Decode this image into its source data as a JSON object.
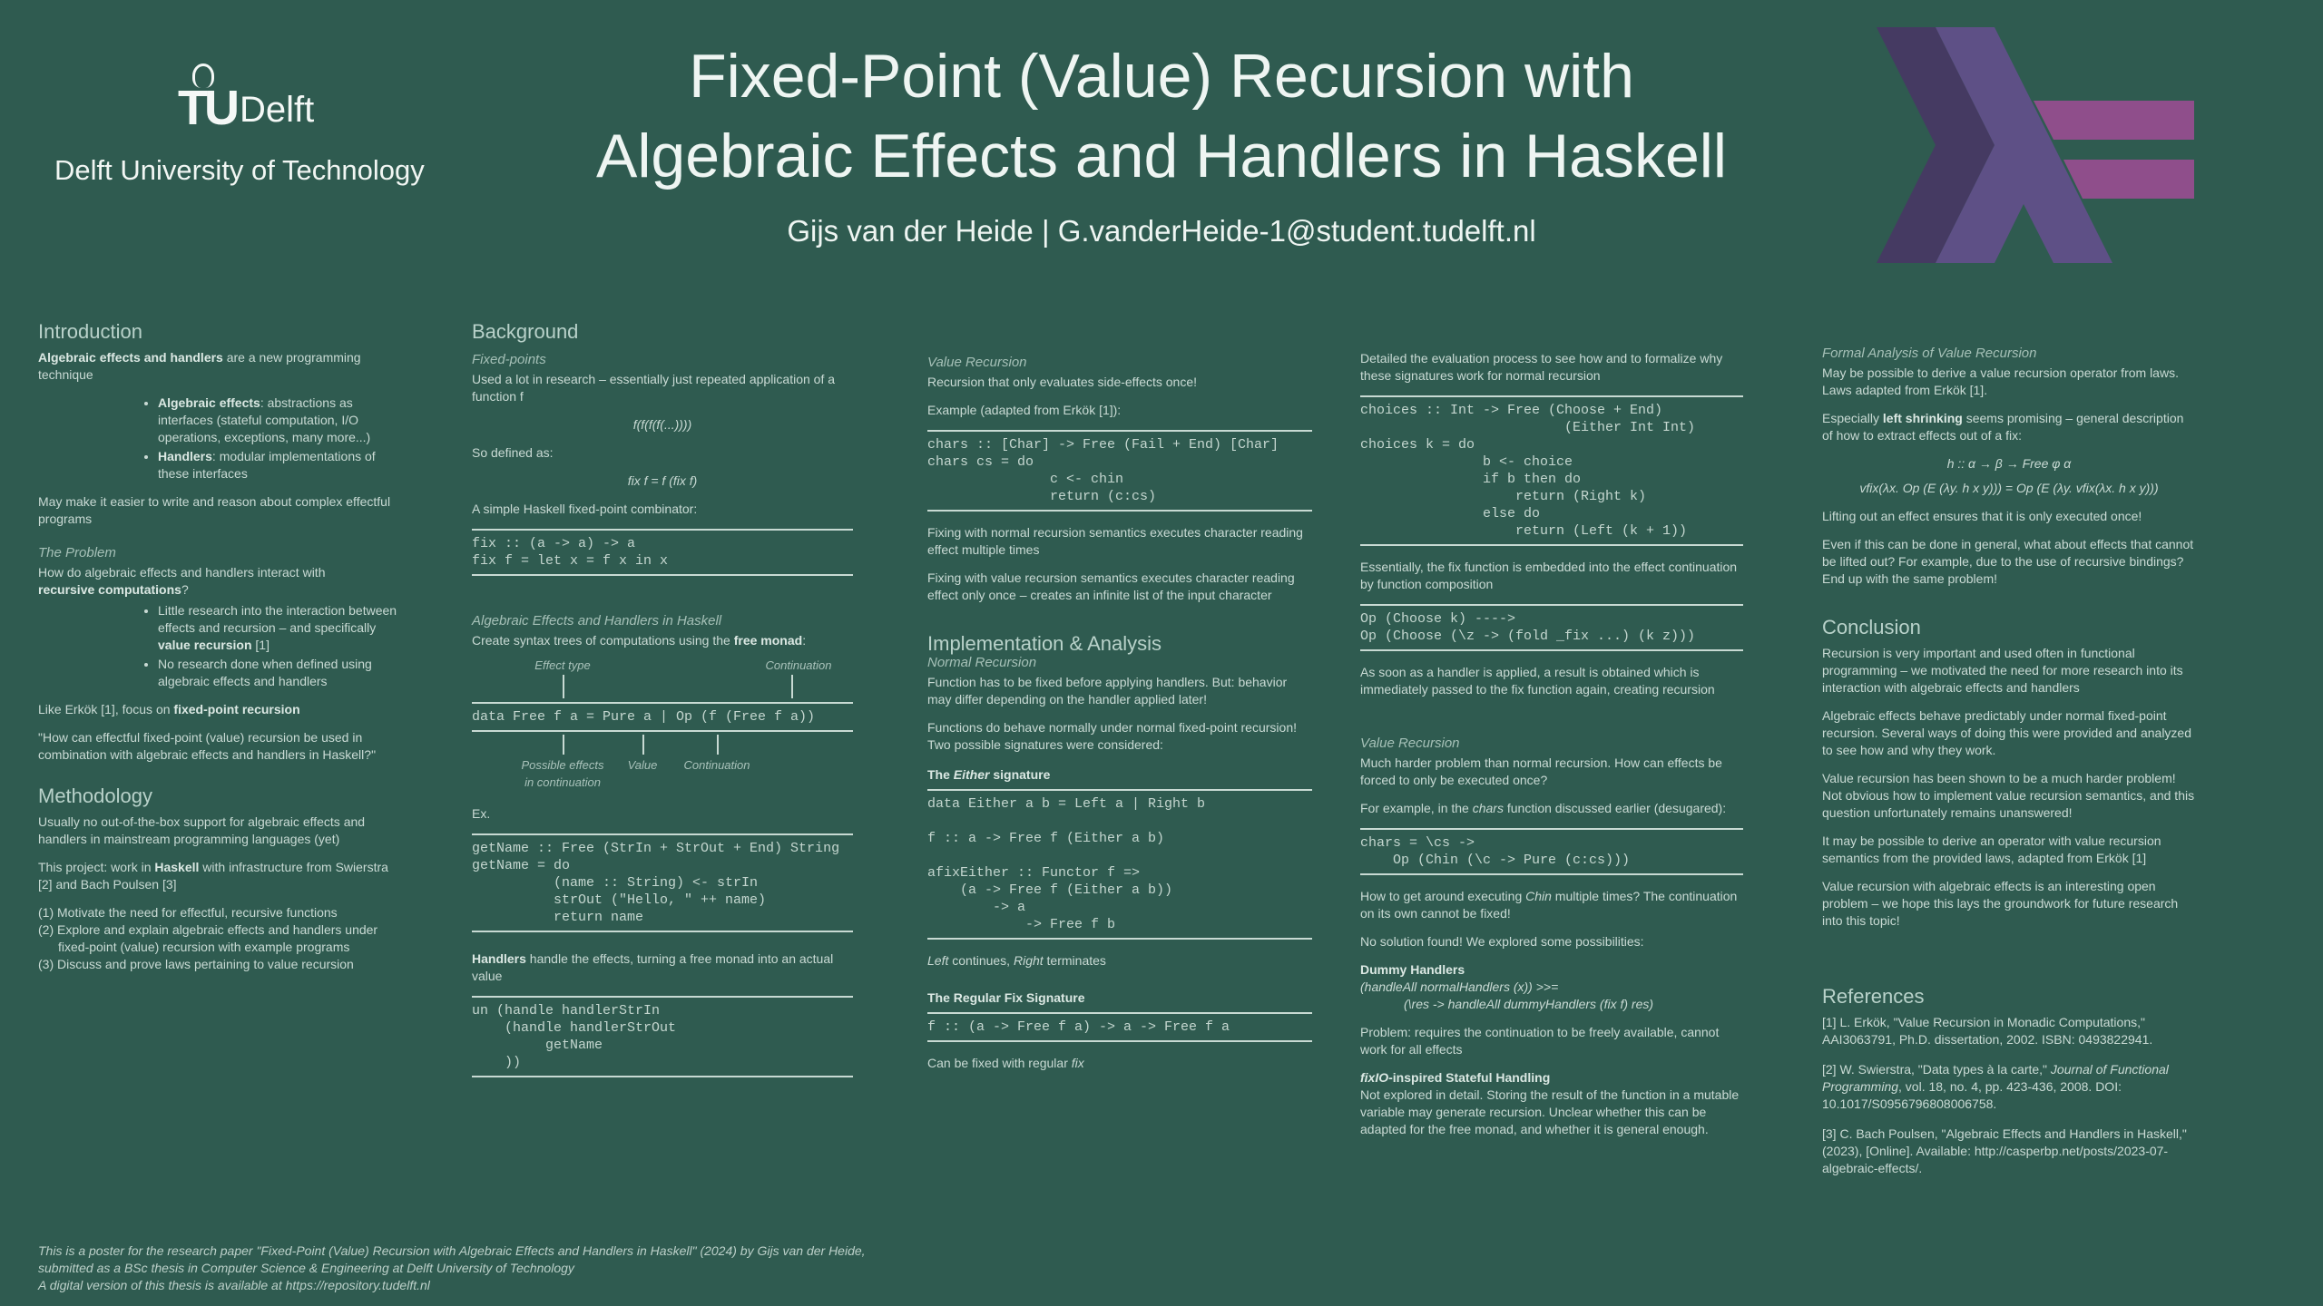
{
  "header": {
    "logo_text": "TU",
    "logo_word": "Delft",
    "university": "Delft University of Technology",
    "title_line1": "Fixed-Point (Value) Recursion with",
    "title_line2": "Algebraic Effects and Handlers in Haskell",
    "author": "Gijs van der Heide | G.vanderHeide-1@student.tudelft.nl",
    "haskell_logo_colors": [
      "#453a62",
      "#5e5086",
      "#8f4e8b"
    ]
  },
  "intro": {
    "heading": "Introduction",
    "p1_bold": "Algebraic effects and handlers",
    "p1_rest": " are a new programming technique",
    "b1_bold": "Algebraic effects",
    "b1_rest": ": abstractions as interfaces (stateful computation, I/O operations, exceptions, many more...)",
    "b2_bold": "Handlers",
    "b2_rest": ": modular implementations of these interfaces",
    "p2": "May make it easier to write and reason about complex effectful programs",
    "problem_heading": "The Problem",
    "problem_p": "How do algebraic effects and handlers interact with",
    "problem_bold": "recursive computations",
    "problem_q": "?",
    "pb1_pre": "Little research into the interaction between effects and recursion – and specifically ",
    "pb1_bold": "value recursion",
    "pb1_post": " [1]",
    "pb2": "No research done when defined using algebraic effects and handlers",
    "erkok_pre": "Like Erkök [1], focus on ",
    "erkok_bold": "fixed-point recursion",
    "question": "\"How can effectful fixed-point (value) recursion be used in combination with algebraic effects and handlers in Haskell?\""
  },
  "method": {
    "heading": "Methodology",
    "p1": "Usually no out-of-the-box support for algebraic effects and handlers in mainstream programming languages (yet)",
    "p2_pre": "This project: work in ",
    "p2_bold": "Haskell",
    "p2_post": " with infrastructure from Swierstra [2] and Bach Poulsen [3]",
    "steps": [
      "(1) Motivate the need for effectful, recursive functions",
      "(2) Explore and explain algebraic effects and handlers under fixed-point (value) recursion with example programs",
      "(3) Discuss and prove laws pertaining to value recursion"
    ]
  },
  "background": {
    "heading": "Background",
    "fp_heading": "Fixed-points",
    "fp_p": "Used a lot in research – essentially just repeated application of a function f",
    "fp_math": "f(f(f(f(...))))",
    "fp_defined": "So defined as:",
    "fp_def": "fix f = f (fix f)",
    "fp_simple": "A simple Haskell fixed-point combinator:",
    "fix_code": "fix :: (a -> a) -> a\nfix f = let x = f x in x",
    "ae_heading": "Algebraic Effects and Handlers in Haskell",
    "ae_p_pre": "Create syntax trees of computations using the ",
    "ae_p_bold": "free monad",
    "ae_p_post": ":",
    "lab_effect_type": "Effect type",
    "lab_continuation_top": "Continuation",
    "free_code": "data Free f a = Pure a | Op (f (Free f a))",
    "lab_possible": "Possible effects in continuation",
    "lab_value": "Value",
    "lab_continuation_bot": "Continuation",
    "ex": "Ex.",
    "getname_code": "getName :: Free (StrIn + StrOut + End) String\ngetName = do\n          (name :: String) <- strIn\n          strOut (\"Hello, \" ++ name)\n          return name",
    "handlers_bold": "Handlers",
    "handlers_rest": " handle the effects, turning a free monad into an actual value",
    "handle_code": "un (handle handlerStrIn\n    (handle handlerStrOut\n         getName\n    ))"
  },
  "value_rec": {
    "heading": "Value Recursion",
    "p1": "Recursion that only evaluates side-effects once!",
    "example": "Example (adapted from Erkök [1]):",
    "chars_code": "chars :: [Char] -> Free (Fail + End) [Char]\nchars cs = do\n               c <- chin\n               return (c:cs)",
    "p2": "Fixing with normal recursion semantics executes character reading effect multiple times",
    "p3": "Fixing with value recursion semantics executes character reading effect only once – creates an infinite list of the input character",
    "impl_heading": "Implementation & Analysis",
    "normal_heading": "Normal Recursion",
    "normal_p1": "Function has to be fixed before applying handlers. But: behavior may differ depending on the handler applied later!",
    "normal_p2": "Functions do behave normally under normal fixed-point recursion! Two possible signatures were considered:",
    "either_sub_pre": "The ",
    "either_sub_it": "Either",
    "either_sub_post": " signature",
    "either_code": "data Either a b = Left a | Right b\n\nf :: a -> Free f (Either a b)\n\nafixEither :: Functor f =>\n    (a -> Free f (Either a b))\n        -> a\n            -> Free f b",
    "either_note_it1": "Left",
    "either_note_mid": " continues, ",
    "either_note_it2": "Right",
    "either_note_post": " terminates",
    "regular_sub": "The Regular Fix Signature",
    "regular_code": "f :: (a -> Free f a) -> a -> Free f a",
    "regular_note_pre": "Can be fixed with regular ",
    "regular_note_it": "fix"
  },
  "col4": {
    "p1": "Detailed the evaluation process to see how and to formalize why these signatures work for normal recursion",
    "choices_code": "choices :: Int -> Free (Choose + End)\n                         (Either Int Int)\nchoices k = do\n               b <- choice\n               if b then do\n                   return (Right k)\n               else do\n                   return (Left (k + 1))",
    "p2": "Essentially, the fix function is embedded into the effect continuation by function composition",
    "cont_code": "Op (Choose k) ---->\nOp (Choose (\\z -> (fold _fix ...) (k z)))",
    "p3": "As soon as a handler is applied, a result is obtained which is immediately passed to the fix function again, creating recursion",
    "vr_heading": "Value Recursion",
    "vr_p1": "Much harder problem than normal recursion. How can effects be forced to only be executed once?",
    "vr_p2_pre": "For example, in the ",
    "vr_p2_it": "chars",
    "vr_p2_post": " function discussed earlier (desugared):",
    "chars2_code": "chars = \\cs ->\n    Op (Chin (\\c -> Pure (c:cs)))",
    "vr_p3_pre": "How to get around executing ",
    "vr_p3_it": "Chin",
    "vr_p3_post": " multiple times? The continuation on its own cannot be fixed!",
    "vr_p4": "No solution found! We explored some possibilities:",
    "dummy_bold": "Dummy Handlers",
    "dummy_line1": "(handleAll normalHandlers (x)) >>=",
    "dummy_line2": "(\\res -> handleAll dummyHandlers (fix f) res)",
    "problem_text": "Problem: requires the continuation to be freely available, cannot work for all effects",
    "fixio_bold_it": "fixIO",
    "fixio_bold_rest": "-inspired Stateful Handling",
    "fixio_p": "Not explored in detail. Storing the result of the function in a mutable variable may generate recursion. Unclear whether this can be adapted for the free monad, and whether it is general enough."
  },
  "col5": {
    "formal_heading": "Formal Analysis of Value Recursion",
    "formal_p1": "May be possible to derive a value recursion operator from laws. Laws adapted from Erkök [1].",
    "formal_p2_pre": "Especially ",
    "formal_p2_bold": "left shrinking",
    "formal_p2_post": " seems promising – general description of how to extract effects out of a fix:",
    "law1": "h :: α → β → Free φ α",
    "law2": "vfix(λx. Op (E (λy. h x y))) = Op (E (λy. vfix(λx. h x y)))",
    "formal_p3": "Lifting out an effect ensures that it is only executed once!",
    "formal_p4": "Even if this can be done in general, what about effects that cannot be lifted out? For example, due to the use of recursive bindings? End up with the same problem!",
    "conclusion_heading": "Conclusion",
    "c1": "Recursion is very important and used often in functional programming – we motivated the need for more research into its interaction with algebraic effects and handlers",
    "c2": "Algebraic effects behave predictably under normal fixed-point recursion. Several ways of doing this were provided and analyzed to see how and why they work.",
    "c3": "Value recursion has been shown to be a much harder problem! Not obvious how to implement value recursion semantics, and this question unfortunately remains unanswered!",
    "c4": "It may be possible to derive an operator with value recursion semantics from the provided laws, adapted from Erkök [1]",
    "c5": "Value recursion with algebraic effects is an interesting open problem – we hope this lays the groundwork for future research into this topic!",
    "refs_heading": "References",
    "r1": "[1] L. Erkök, \"Value Recursion in Monadic Computations,\" AAI3063791, Ph.D. dissertation, 2002. ISBN: 0493822941.",
    "r2_pre": "[2] W. Swierstra, \"Data types à la carte,\" ",
    "r2_it": "Journal of Functional Programming",
    "r2_post": ", vol. 18, no. 4, pp. 423-436, 2008. DOI: 10.1017/S0956796808006758.",
    "r3": "[3] C. Bach Poulsen, \"Algebraic Effects and Handlers in Haskell,\" (2023), [Online]. Available: http://casperbp.net/posts/2023-07-algebraic-effects/."
  },
  "footer": {
    "line1": "This is a poster for the research paper \"Fixed-Point (Value) Recursion with Algebraic Effects and Handlers in Haskell\" (2024) by Gijs van der Heide,",
    "line2": "submitted as a BSc thesis in Computer Science & Engineering at Delft University of Technology",
    "line3": "A digital version of this thesis is available at https://repository.tudelft.nl"
  }
}
